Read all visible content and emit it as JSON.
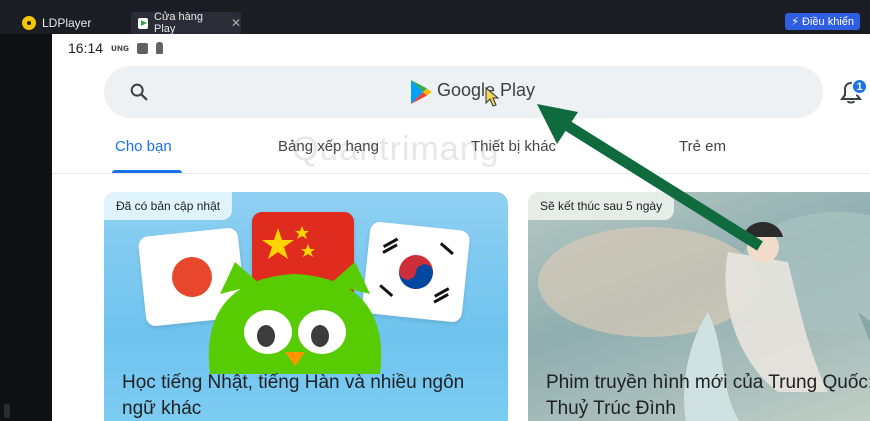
{
  "window": {
    "app_title": "LDPlayer",
    "tab_label": "Cửa hàng Play",
    "tab_close": "✕",
    "control_button": "Điều khiển",
    "control_icon": "lightning-icon"
  },
  "status_bar": {
    "time": "16:14",
    "carrier": "ᴜɴɢ"
  },
  "search": {
    "brand": "Google Play",
    "search_icon": "search-icon",
    "notification_count": "1"
  },
  "tabs": [
    {
      "label": "Cho bạn",
      "active": true
    },
    {
      "label": "Bảng xếp hạng",
      "active": false
    },
    {
      "label": "Thiết bị khác",
      "active": false
    },
    {
      "label": "Trẻ em",
      "active": false
    }
  ],
  "watermark": "Quantrimang",
  "cards": [
    {
      "badge": "Đã có bản cập nhật",
      "title": "Học tiếng Nhật, tiếng Hàn và nhiều ngôn ngữ khác"
    },
    {
      "badge": "Sẽ kết thúc sau 5 ngày",
      "title": "Phim truyền hình mới của Trung Quốc: Hoài Thuỷ Trúc Đình"
    }
  ],
  "colors": {
    "accent": "#1a73e8",
    "arrow": "#0f6b3e",
    "ld_bar": "#1b1d24"
  }
}
